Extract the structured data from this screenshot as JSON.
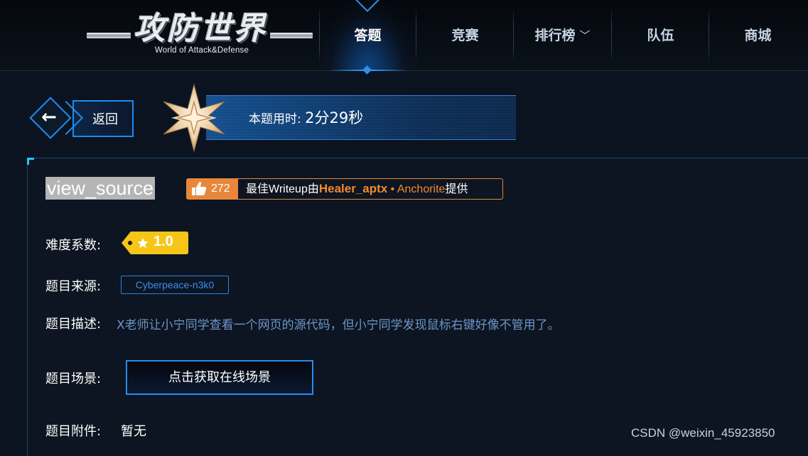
{
  "logo": {
    "title": "攻防世界",
    "subtitle": "World of Attack&Defense"
  },
  "nav": {
    "items": [
      {
        "label": "答题"
      },
      {
        "label": "竞赛"
      },
      {
        "label": "排行榜"
      },
      {
        "label": "队伍"
      },
      {
        "label": "商城"
      }
    ],
    "caret": "﹀"
  },
  "back": {
    "label": "返回",
    "arrow": "←"
  },
  "timer": {
    "prefix": "本题用时:",
    "value": "2分29秒"
  },
  "challenge": {
    "title": "view_source",
    "likes": "272",
    "writeup_prefix": "最佳Writeup由",
    "writeup_author": "Healer_aptx",
    "writeup_sep": " • ",
    "writeup_second": "Anchorite",
    "writeup_suffix": "提供",
    "difficulty_label": "难度系数:",
    "difficulty_value": "1.0",
    "source_label": "题目来源:",
    "source_value": "Cyberpeace-n3k0",
    "desc_label": "题目描述:",
    "desc_value": "X老师让小宁同学查看一个网页的源代码，但小宁同学发现鼠标右键好像不管用了。",
    "scene_label": "题目场景:",
    "scene_button": "点击获取在线场景",
    "attach_label": "题目附件:",
    "attach_value": "暂无"
  },
  "watermark": "CSDN @weixin_45923850",
  "colors": {
    "accent": "#1e8cf0",
    "orange": "#e8873a",
    "badge_yellow": "#f5c518",
    "desc_blue": "#6e95c9"
  }
}
